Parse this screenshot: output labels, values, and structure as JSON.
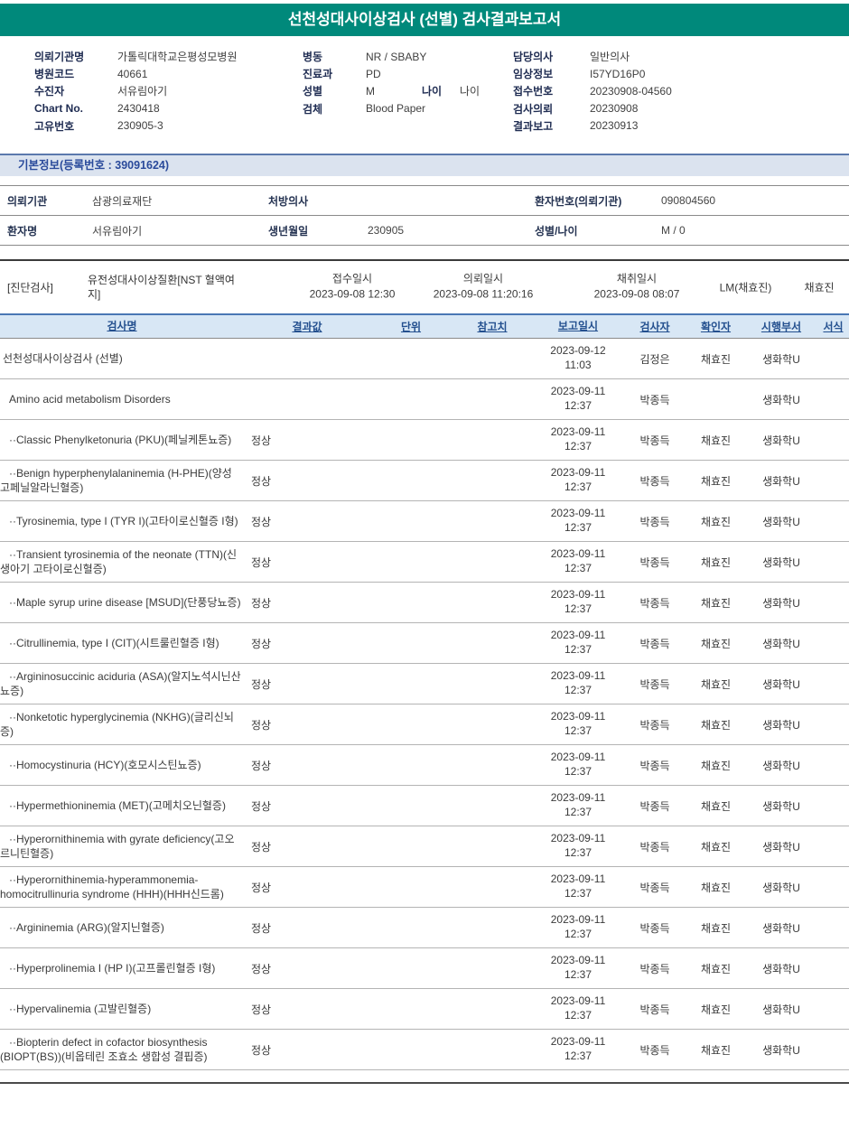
{
  "header": {
    "title": "선천성대사이상검사 (선별) 검사결과보고서",
    "banner_color": "#00897b"
  },
  "info": {
    "left": [
      {
        "label": "의뢰기관명",
        "value": "가톨릭대학교은평성모병원"
      },
      {
        "label": "병원코드",
        "value": "40661"
      },
      {
        "label": "수진자",
        "value": "서유림아기"
      },
      {
        "label": "Chart No.",
        "value": "2430418"
      },
      {
        "label": "고유번호",
        "value": "230905-3"
      }
    ],
    "middle": [
      {
        "label": "병동",
        "value": "NR / SBABY"
      },
      {
        "label": "진료과",
        "value": "PD"
      },
      {
        "label": "성별",
        "value": "M",
        "label2": "나이",
        "value2": "나이"
      },
      {
        "label": "검체",
        "value": "Blood Paper"
      }
    ],
    "right": [
      {
        "label": "담당의사",
        "value": "일반의사"
      },
      {
        "label": "임상정보",
        "value": "I57YD16P0"
      },
      {
        "label": "접수번호",
        "value": "20230908-04560"
      },
      {
        "label": "검사의뢰",
        "value": "20230908"
      },
      {
        "label": "결과보고",
        "value": "20230913"
      }
    ]
  },
  "basic_info": {
    "title": "기본정보(등록번호 : 39091624)",
    "row1": {
      "label1": "의뢰기관",
      "value1": "삼광의료재단",
      "label2": "처방의사",
      "value2": "",
      "label3": "환자번호(의뢰기관)",
      "value3": "090804560"
    },
    "row2": {
      "label1": "환자명",
      "value1": "서유림아기",
      "label2": "생년월일",
      "value2": "230905",
      "label3": "성별/나이",
      "value3": "M / 0"
    }
  },
  "order": {
    "tag": "[진단검사]",
    "test_group": "유전성대사이상질환[NST 혈액여지]",
    "receipt_label": "접수일시",
    "receipt_value": "2023-09-08 12:30",
    "request_label": "의뢰일시",
    "request_value": "2023-09-08 11:20:16",
    "collect_label": "채취일시",
    "collect_value": "2023-09-08 08:07",
    "collector": "LM(채효진)",
    "confirmer": "채효진"
  },
  "results_table": {
    "headers": [
      "검사명",
      "결과값",
      "단위",
      "참고치",
      "보고일시",
      "검사자",
      "확인자",
      "시행부서",
      "서식"
    ],
    "rows": [
      {
        "level": 0,
        "name": "선천성대사이상검사 (선별)",
        "result": "",
        "report_date": "2023-09-12",
        "report_time": "11:03",
        "tester": "김정은",
        "confirmer": "채효진",
        "dept": "생화학U"
      },
      {
        "level": 1,
        "name": "Amino acid metabolism Disorders",
        "result": "",
        "report_date": "2023-09-11",
        "report_time": "12:37",
        "tester": "박종득",
        "confirmer": "",
        "dept": "생화학U"
      },
      {
        "level": 2,
        "name": "··Classic Phenylketonuria (PKU)(페닐케톤뇨증)",
        "result": "정상",
        "report_date": "2023-09-11",
        "report_time": "12:37",
        "tester": "박종득",
        "confirmer": "채효진",
        "dept": "생화학U"
      },
      {
        "level": 2,
        "name": "··Benign hyperphenylalaninemia (H-PHE)(양성 고페닐알라닌혈증)",
        "result": "정상",
        "report_date": "2023-09-11",
        "report_time": "12:37",
        "tester": "박종득",
        "confirmer": "채효진",
        "dept": "생화학U"
      },
      {
        "level": 2,
        "name": "··Tyrosinemia, type I (TYR I)(고타이로신혈증 I형)",
        "result": "정상",
        "report_date": "2023-09-11",
        "report_time": "12:37",
        "tester": "박종득",
        "confirmer": "채효진",
        "dept": "생화학U"
      },
      {
        "level": 2,
        "name": "··Transient tyrosinemia of the neonate (TTN)(신생아기 고타이로신혈증)",
        "result": "정상",
        "report_date": "2023-09-11",
        "report_time": "12:37",
        "tester": "박종득",
        "confirmer": "채효진",
        "dept": "생화학U"
      },
      {
        "level": 2,
        "name": "··Maple syrup urine disease [MSUD](단풍당뇨증)",
        "result": "정상",
        "report_date": "2023-09-11",
        "report_time": "12:37",
        "tester": "박종득",
        "confirmer": "채효진",
        "dept": "생화학U"
      },
      {
        "level": 2,
        "name": "··Citrullinemia, type I (CIT)(시트룰린혈증 I형)",
        "result": "정상",
        "report_date": "2023-09-11",
        "report_time": "12:37",
        "tester": "박종득",
        "confirmer": "채효진",
        "dept": "생화학U"
      },
      {
        "level": 2,
        "name": "··Argininosuccinic aciduria (ASA)(알지노석시닌산뇨증)",
        "result": "정상",
        "report_date": "2023-09-11",
        "report_time": "12:37",
        "tester": "박종득",
        "confirmer": "채효진",
        "dept": "생화학U"
      },
      {
        "level": 2,
        "name": "··Nonketotic hyperglycinemia (NKHG)(글리신뇌증)",
        "result": "정상",
        "report_date": "2023-09-11",
        "report_time": "12:37",
        "tester": "박종득",
        "confirmer": "채효진",
        "dept": "생화학U"
      },
      {
        "level": 2,
        "name": "··Homocystinuria (HCY)(호모시스틴뇨증)",
        "result": "정상",
        "report_date": "2023-09-11",
        "report_time": "12:37",
        "tester": "박종득",
        "confirmer": "채효진",
        "dept": "생화학U"
      },
      {
        "level": 2,
        "name": "··Hypermethioninemia (MET)(고메치오닌혈증)",
        "result": "정상",
        "report_date": "2023-09-11",
        "report_time": "12:37",
        "tester": "박종득",
        "confirmer": "채효진",
        "dept": "생화학U"
      },
      {
        "level": 2,
        "name": "··Hyperornithinemia with gyrate deficiency(고오르니틴혈증)",
        "result": "정상",
        "report_date": "2023-09-11",
        "report_time": "12:37",
        "tester": "박종득",
        "confirmer": "채효진",
        "dept": "생화학U"
      },
      {
        "level": 2,
        "name": "··Hyperornithinemia-hyperammonemia-homocitrullinuria syndrome (HHH)(HHH신드롬)",
        "result": "정상",
        "report_date": "2023-09-11",
        "report_time": "12:37",
        "tester": "박종득",
        "confirmer": "채효진",
        "dept": "생화학U"
      },
      {
        "level": 2,
        "name": "··Argininemia (ARG)(알지닌혈증)",
        "result": "정상",
        "report_date": "2023-09-11",
        "report_time": "12:37",
        "tester": "박종득",
        "confirmer": "채효진",
        "dept": "생화학U"
      },
      {
        "level": 2,
        "name": "··Hyperprolinemia I (HP I)(고프롤린혈증 I형)",
        "result": "정상",
        "report_date": "2023-09-11",
        "report_time": "12:37",
        "tester": "박종득",
        "confirmer": "채효진",
        "dept": "생화학U"
      },
      {
        "level": 2,
        "name": "··Hypervalinemia (고발린혈증)",
        "result": "정상",
        "report_date": "2023-09-11",
        "report_time": "12:37",
        "tester": "박종득",
        "confirmer": "채효진",
        "dept": "생화학U"
      },
      {
        "level": 2,
        "name": "··Biopterin defect in cofactor biosynthesis (BIOPT(BS))(비옵테린 조효소 생합성 결핍증)",
        "result": "정상",
        "report_date": "2023-09-11",
        "report_time": "12:37",
        "tester": "박종득",
        "confirmer": "채효진",
        "dept": "생화학U"
      }
    ]
  }
}
